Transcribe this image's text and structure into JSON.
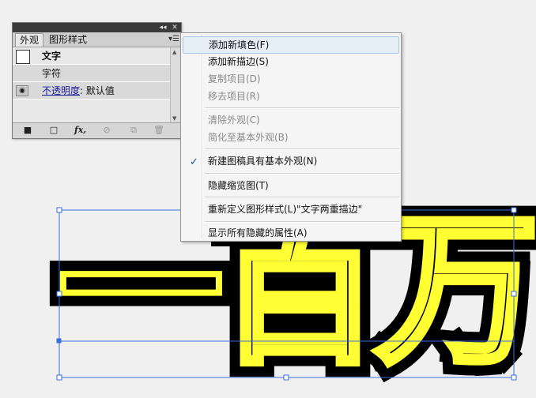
{
  "panel": {
    "tabs": [
      {
        "label": "外观",
        "active": true
      },
      {
        "label": "图形样式",
        "active": false
      }
    ],
    "rows": [
      {
        "type": "header",
        "label": "文字"
      },
      {
        "type": "item",
        "label": "字符"
      },
      {
        "type": "opacity",
        "label_link": "不透明度",
        "label_value": ": 默认值"
      }
    ],
    "topbar_buttons": [
      "◂◂",
      "✕"
    ],
    "bottom_icons": [
      "new-stroke-icon",
      "new-fill-icon",
      "fx-icon",
      "clear-icon",
      "duplicate-icon",
      "delete-icon"
    ],
    "fx_glyph": "fx,"
  },
  "menu": {
    "items": [
      {
        "label": "添加新填色(F)",
        "disabled": false,
        "hover": true
      },
      {
        "label": "添加新描边(S)",
        "disabled": false
      },
      {
        "label": "复制项目(D)",
        "disabled": true
      },
      {
        "label": "移去项目(R)",
        "disabled": true
      },
      {
        "label": "清除外观(C)",
        "disabled": true
      },
      {
        "label": "简化至基本外观(B)",
        "disabled": true
      },
      {
        "label": "新建图稿具有基本外观(N)",
        "disabled": false,
        "checked": true
      },
      {
        "label": "隐藏缩览图(T)",
        "disabled": false
      },
      {
        "label": "重新定义图形样式(L)\"文字两重描边\"",
        "disabled": false
      },
      {
        "label": "显示所有隐藏的属性(A)",
        "disabled": false
      }
    ],
    "check_glyph": "✓"
  },
  "artwork": {
    "text": "一百万",
    "fill_color": "#ffff33",
    "stroke_color": "#000000"
  },
  "colors": {
    "selection": "#3a6fd8",
    "panel_bg": "#e8e8e8",
    "menu_bg": "#f5f5f5"
  }
}
